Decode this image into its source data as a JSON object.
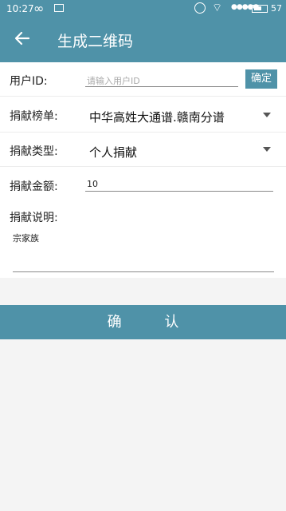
{
  "status_bar": {
    "time": "10:27",
    "battery": "57",
    "icons": [
      "infinity-icon",
      "image-icon",
      "alarm-icon",
      "wifi-icon",
      "signal-icon",
      "battery-icon"
    ]
  },
  "app_bar": {
    "title": "生成二维码",
    "back_icon": "arrow-left-icon"
  },
  "form": {
    "user_id": {
      "label": "用户ID:",
      "placeholder": "请输入用户ID",
      "value": "",
      "button": "确定"
    },
    "donation_list": {
      "label": "捐献榜单:",
      "value": "中华高姓大通谱.赣南分谱"
    },
    "donation_type": {
      "label": "捐献类型:",
      "value": "个人捐献"
    },
    "donation_amount": {
      "label": "捐献金额:",
      "value": "10"
    },
    "donation_note": {
      "label": "捐献说明:",
      "value": "宗家族"
    }
  },
  "submit": {
    "label": "确 认"
  },
  "colors": {
    "primary": "#4f92a8",
    "background": "#f4f4f4",
    "surface": "#ffffff"
  }
}
